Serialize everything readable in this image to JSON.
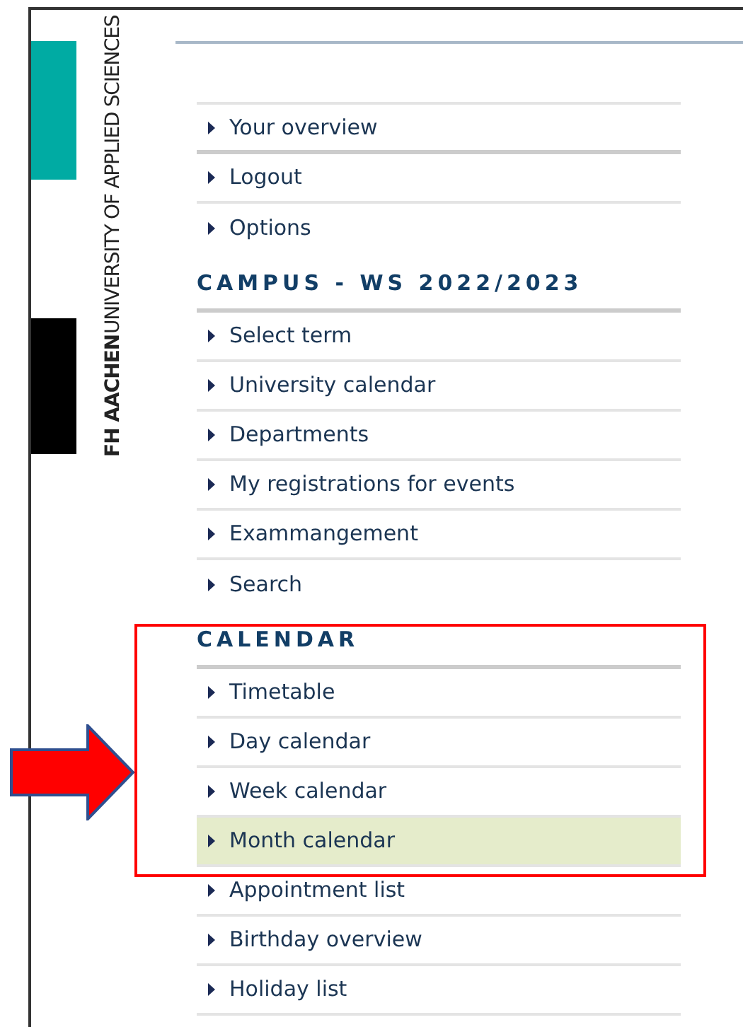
{
  "logo": {
    "name": "FH AACHEN",
    "tagline": "UNIVERSITY OF APPLIED SCIENCES"
  },
  "sections": [
    {
      "items": [
        {
          "label": "Your overview",
          "selected": false
        },
        {
          "label": "Logout",
          "selected": false
        },
        {
          "label": "Options",
          "selected": false
        }
      ]
    },
    {
      "title": "CAMPUS - WS 2022/2023",
      "items": [
        {
          "label": "Select term",
          "selected": false
        },
        {
          "label": "University calendar",
          "selected": false
        },
        {
          "label": "Departments",
          "selected": false
        },
        {
          "label": "My registrations for events",
          "selected": false
        },
        {
          "label": "Exammangement",
          "selected": false
        },
        {
          "label": "Search",
          "selected": false
        }
      ]
    },
    {
      "title": "CALENDAR",
      "items": [
        {
          "label": "Timetable",
          "selected": false
        },
        {
          "label": "Day calendar",
          "selected": false
        },
        {
          "label": "Week calendar",
          "selected": false
        },
        {
          "label": "Month calendar",
          "selected": true
        },
        {
          "label": "Appointment list",
          "selected": false
        },
        {
          "label": "Birthday overview",
          "selected": false
        },
        {
          "label": "Holiday list",
          "selected": false
        }
      ]
    }
  ]
}
